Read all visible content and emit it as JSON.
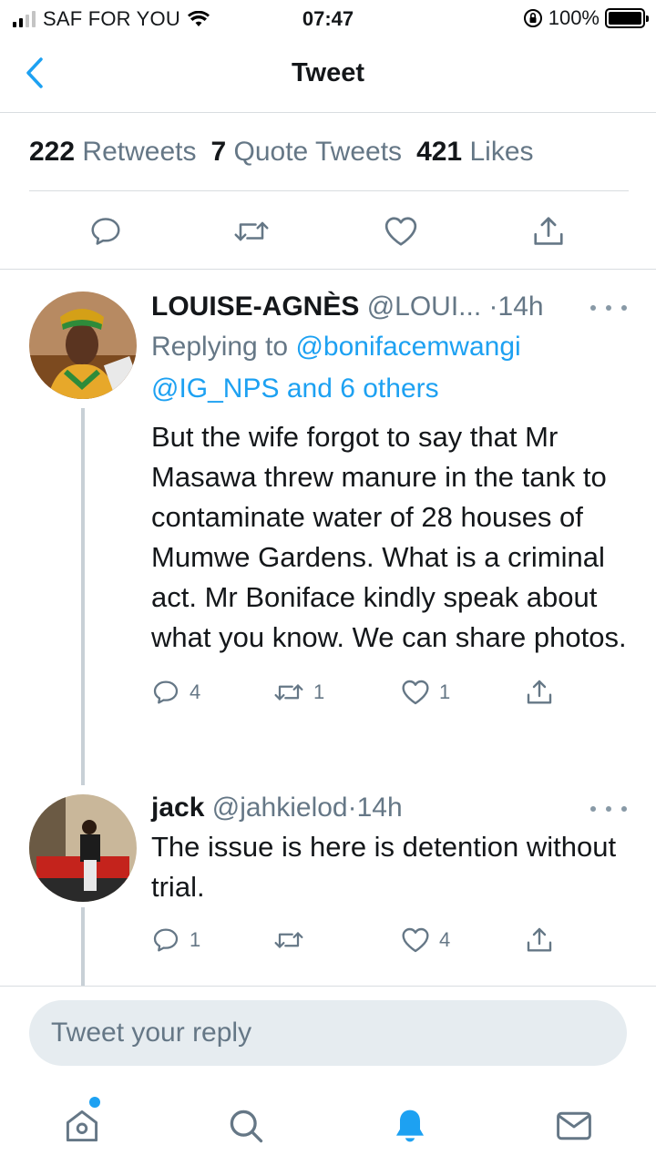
{
  "status_bar": {
    "carrier": "SAF FOR YOU",
    "time": "07:47",
    "battery": "100%"
  },
  "header": {
    "title": "Tweet"
  },
  "stats": [
    {
      "count": "222",
      "label": "Retweets"
    },
    {
      "count": "7",
      "label": "Quote Tweets"
    },
    {
      "count": "421",
      "label": "Likes"
    }
  ],
  "replies": [
    {
      "name": "LOUISE-AGNÈS",
      "handle": "@LOUI...",
      "dot": "·",
      "time": "14h",
      "replying_prefix": "Replying to",
      "replying_to_1": "@bonifacemwangi",
      "replying_to_2": "@IG_NPS and 6 others",
      "text": "But the wife forgot to say that Mr Masawa threw manure in the tank to contaminate water of 28 houses of Mumwe Gardens. What is a criminal act. Mr Boniface kindly speak about what you know. We can share photos.",
      "reply_count": "4",
      "retweet_count": "1",
      "like_count": "1"
    },
    {
      "name": "jack",
      "handle": "@jahkielod",
      "dot": "·",
      "time": "14h",
      "text": "The issue is here is detention without trial.",
      "reply_count": "1",
      "retweet_count": "",
      "like_count": "4"
    }
  ],
  "reply_box": {
    "placeholder": "Tweet your reply"
  },
  "colors": {
    "accent": "#1da1f2",
    "secondary_text": "#657786",
    "divider": "#d9dde0",
    "input_bg": "#e6ecf0"
  },
  "icons": {
    "back": "chevron-left-icon",
    "reply": "comment-icon",
    "retweet": "retweet-icon",
    "like": "heart-icon",
    "share": "share-icon",
    "more": "more-icon",
    "home": "home-icon",
    "search": "search-icon",
    "notifications": "bell-icon",
    "messages": "mail-icon"
  }
}
